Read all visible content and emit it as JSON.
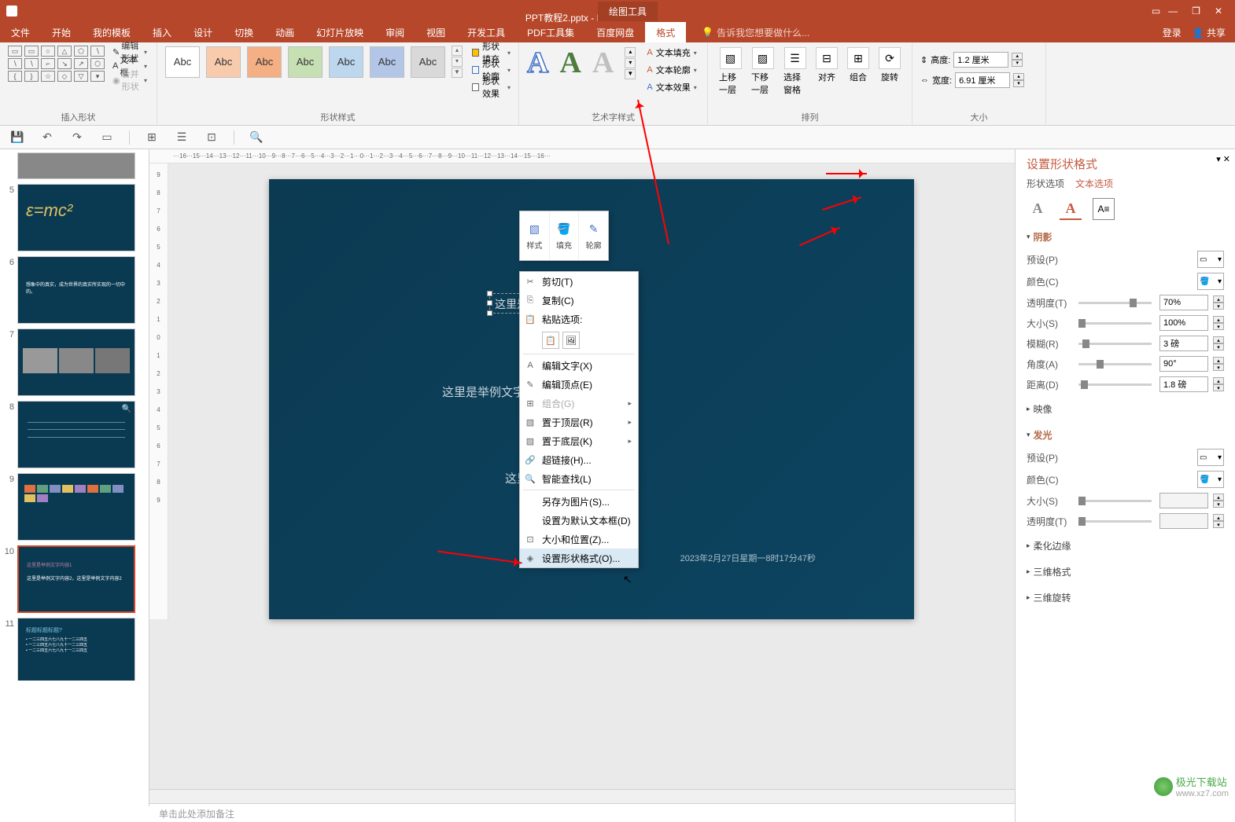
{
  "titlebar": {
    "filename": "PPT教程2.pptx - PowerPoint",
    "drawing_tools": "绘图工具",
    "display_settings_icon": "▭",
    "minimize": "—",
    "restore": "❐",
    "close": "✕"
  },
  "tabs": {
    "items": [
      "文件",
      "开始",
      "我的模板",
      "插入",
      "设计",
      "切换",
      "动画",
      "幻灯片放映",
      "审阅",
      "视图",
      "开发工具",
      "PDF工具集",
      "百度网盘",
      "格式"
    ],
    "active_index": 13,
    "tell_me": "告诉我您想要做什么...",
    "login": "登录",
    "share": "共享"
  },
  "ribbon": {
    "group_insert_shape": "插入形状",
    "insert_shape_opts": {
      "edit_shape": "编辑形状",
      "textbox": "文本框",
      "merge_shape": "合并形状"
    },
    "group_shape_style": "形状样式",
    "style_label": "Abc",
    "shape_opts": {
      "fill": "形状填充",
      "outline": "形状轮廓",
      "effects": "形状效果"
    },
    "group_wordart": "艺术字样式",
    "wordart_letter": "A",
    "text_opts": {
      "fill": "文本填充",
      "outline": "文本轮廓",
      "effects": "文本效果"
    },
    "group_arrange": "排列",
    "arrange": {
      "bring_fwd": "上移一层",
      "send_back": "下移一层",
      "selection": "选择窗格",
      "align": "对齐",
      "group": "组合",
      "rotate": "旋转"
    },
    "group_size": "大小",
    "size": {
      "height_label": "高度:",
      "height": "1.2 厘米",
      "width_label": "宽度:",
      "width": "6.91 厘米"
    }
  },
  "slides": {
    "thumbs": [
      {
        "num": "5",
        "img": "formula"
      },
      {
        "num": "6",
        "img": "quote"
      },
      {
        "num": "7",
        "img": "photos"
      },
      {
        "num": "8",
        "img": "table"
      },
      {
        "num": "9",
        "img": "gallery"
      },
      {
        "num": "10",
        "img": "text",
        "active": true
      },
      {
        "num": "11",
        "img": "bullets"
      }
    ],
    "partial_top": {
      "num": "",
      "img": "cropped"
    }
  },
  "canvas": {
    "text1": "这里是举例文字内容1",
    "text2": "这里是举例文字内容2，这里是",
    "text3": "这里是举例内容3。",
    "datetime": "2023年2月27日星期一8时17分47秒"
  },
  "minitb": {
    "style": "样式",
    "fill": "填充",
    "outline": "轮廓"
  },
  "context": {
    "cut": "剪切(T)",
    "copy": "复制(C)",
    "paste_opts_label": "粘贴选项:",
    "edit_text": "编辑文字(X)",
    "edit_points": "编辑顶点(E)",
    "group": "组合(G)",
    "bring_front": "置于顶层(R)",
    "send_back": "置于底层(K)",
    "hyperlink": "超链接(H)...",
    "smart_lookup": "智能查找(L)",
    "save_as_pic": "另存为图片(S)...",
    "set_default": "设置为默认文本框(D)",
    "size_pos": "大小和位置(Z)...",
    "format_shape": "设置形状格式(O)..."
  },
  "formatpane": {
    "title": "设置形状格式",
    "tab_shape": "形状选项",
    "tab_text": "文本选项",
    "sections": {
      "shadow": "阴影",
      "reflection": "映像",
      "glow": "发光",
      "soft_edge": "柔化边缘",
      "threed_fmt": "三维格式",
      "threed_rot": "三维旋转"
    },
    "rows": {
      "preset": "预设(P)",
      "color": "颜色(C)",
      "transparency": "透明度(T)",
      "size": "大小(S)",
      "blur": "模糊(R)",
      "angle": "角度(A)",
      "distance": "距离(D)"
    },
    "values": {
      "transparency": "70%",
      "size": "100%",
      "blur": "3 磅",
      "angle": "90°",
      "distance": "1.8 磅"
    }
  },
  "ruler_h": "···16···15···14···13···12···11···10···9···8···7···6···5···4···3···2···1···0···1···2···3···4···5···6···7···8···9···10···11···12···13···14···15···16···",
  "ruler_v": [
    "9",
    "8",
    "7",
    "6",
    "5",
    "4",
    "3",
    "2",
    "1",
    "0",
    "1",
    "2",
    "3",
    "4",
    "5",
    "6",
    "7",
    "8",
    "9"
  ],
  "notes": "单击此处添加备注",
  "watermark": {
    "brand": "极光下载站",
    "url": "www.xz7.com"
  }
}
